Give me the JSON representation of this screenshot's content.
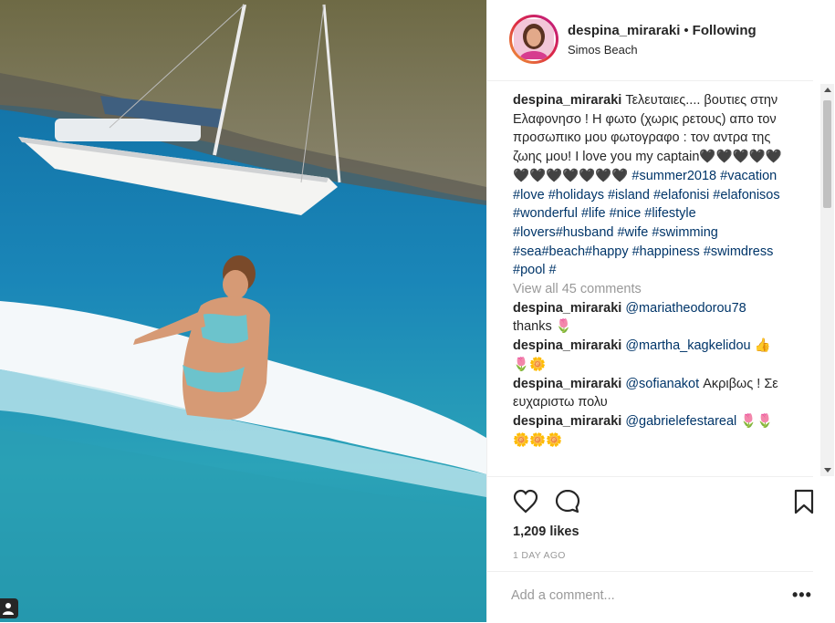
{
  "header": {
    "username": "despina_miraraki",
    "separator": "•",
    "follow_status": "Following",
    "location": "Simos Beach"
  },
  "caption": {
    "username": "despina_miraraki",
    "text": "Τελευταιες.... βουτιες στην Ελαφονησο ! Η φωτο (χωρις ρετους) απο τον προσωπικο μου φωτογραφο : τον αντρα της ζωης μου! I love you my captain🖤🖤🖤🖤🖤🖤🖤🖤🖤🖤🖤🖤",
    "hashtags": "#summer2018 #vacation #love #holidays #island #elafonisi #elafonisos #wonderful #life #nice #lifestyle #lovers#husband #wife #swimming #sea#beach#happy #happiness #swimdress #pool #"
  },
  "view_all_comments": "View all 45 comments",
  "comments": [
    {
      "username": "despina_miraraki",
      "mention": "@mariatheodorou78",
      "text": "thanks 🌷"
    },
    {
      "username": "despina_miraraki",
      "mention": "@martha_kagkelidou",
      "text": "👍🌷🌼"
    },
    {
      "username": "despina_miraraki",
      "mention": "@sofianakot",
      "text": "Ακριβως ! Σε ευχαριστω πολυ"
    },
    {
      "username": "despina_miraraki",
      "mention": "@gabrielefestareal",
      "text": "🌷🌷🌼🌼🌼"
    }
  ],
  "actions": {
    "like_icon": "heart-outline-icon",
    "comment_icon": "speech-bubble-icon",
    "save_icon": "bookmark-icon"
  },
  "likes": "1,209 likes",
  "timestamp": "1 DAY AGO",
  "comment_box": {
    "placeholder": "Add a comment...",
    "more_label": "•••"
  },
  "colors": {
    "link": "#003569",
    "muted": "#999999",
    "text": "#262626",
    "border": "#efefef"
  }
}
